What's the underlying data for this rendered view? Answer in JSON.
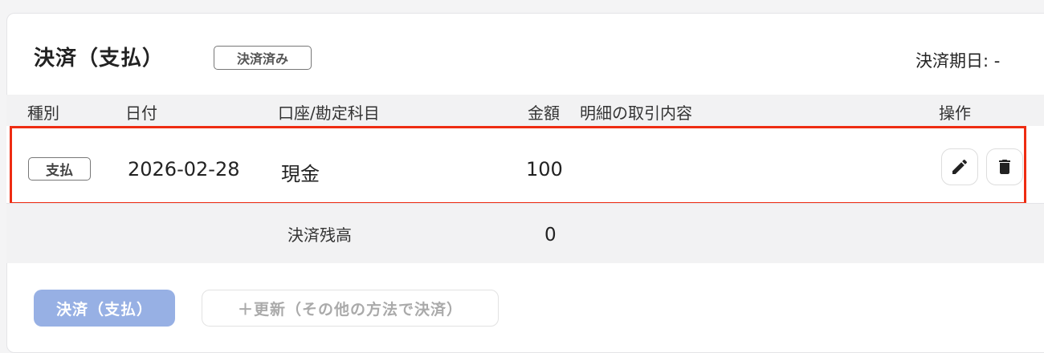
{
  "section": {
    "title": "決済（支払）",
    "status_badge": "決済済み",
    "due_date_label": "決済期日: -"
  },
  "table": {
    "headers": {
      "type": "種別",
      "date": "日付",
      "account": "口座/勘定科目",
      "amount": "金額",
      "description": "明細の取引内容",
      "actions": "操作"
    },
    "rows": [
      {
        "type": "支払",
        "date": "2026-02-28",
        "account": "現金",
        "amount": "100",
        "description": "",
        "actions": [
          "edit-icon",
          "trash-icon"
        ]
      }
    ],
    "balance": {
      "label": "決済残高",
      "value": "0"
    }
  },
  "buttons": {
    "primary": "決済（支払）",
    "secondary": "＋更新（その他の方法で決済）"
  },
  "colors": {
    "highlight": "#ee2c12",
    "primary_button": "#97b0e4"
  }
}
